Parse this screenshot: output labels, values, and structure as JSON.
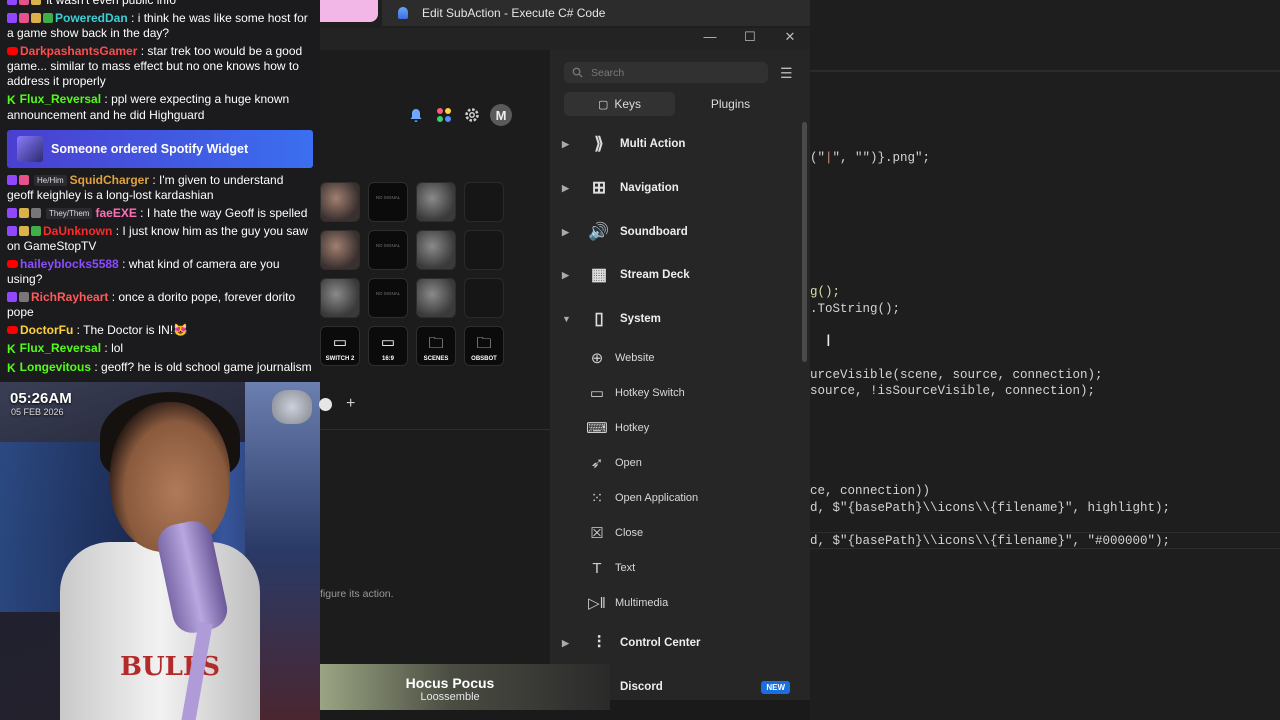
{
  "chat": {
    "messages": [
      {
        "badges": [
          "tw",
          "sub",
          "gold"
        ],
        "user": "",
        "user_color": "#5b8cff",
        "text": "it wasn't even public info"
      },
      {
        "badges": [
          "tw",
          "sub",
          "gold",
          "mod"
        ],
        "user": "PoweredDan",
        "user_color": "#3ad0d6",
        "text": ": i think he was like some host for a game show back in the day?"
      },
      {
        "badges": [
          "yt"
        ],
        "user": "DarkpashantsGamer",
        "user_color": "#ff4d4d",
        "text": ": star trek too would be a good game... similar to mass effect but no one knows how to address it properly"
      },
      {
        "badges": [
          "kick"
        ],
        "user": "Flux_Reversal",
        "user_color": "#53fc18",
        "text": ": ppl were expecting a huge known announcement and he did Highguard"
      },
      {
        "badges": [
          "tw",
          "sub"
        ],
        "pronoun": "He/Him",
        "user": "SquidCharger",
        "user_color": "#e0a23c",
        "text": ": I'm given to understand geoff keighley is a long-lost kardashian"
      },
      {
        "badges": [
          "tw",
          "gold",
          "gray"
        ],
        "pronoun": "They/Them",
        "user": "faeEXE",
        "user_color": "#ff6fb5",
        "text": ": I hate the way Geoff is spelled"
      },
      {
        "badges": [
          "tw",
          "gold",
          "mod"
        ],
        "user": "DaUnknown",
        "user_color": "#ff2a2a",
        "text": ": I just know him as the guy you saw on GameStopTV"
      },
      {
        "badges": [
          "yt"
        ],
        "user": "haileyblocks5588",
        "user_color": "#8a4dff",
        "text": ": what kind of camera are you using?"
      },
      {
        "badges": [
          "tw",
          "gray"
        ],
        "user": "RichRayheart",
        "user_color": "#ff5a5a",
        "text": ": once a dorito pope, forever dorito pope"
      },
      {
        "badges": [
          "yt"
        ],
        "user": "DoctorFu",
        "user_color": "#ffd23c",
        "text": ": The Doctor is IN!😻"
      },
      {
        "badges": [
          "kick"
        ],
        "user": "Flux_Reversal",
        "user_color": "#53fc18",
        "text": ": lol"
      },
      {
        "badges": [
          "kick"
        ],
        "user": "Longevitous",
        "user_color": "#53fc18",
        "text": ": geoff? he is old school game journalism"
      }
    ],
    "alert": "Someone ordered Spotify Widget"
  },
  "overlay": {
    "time": "05:26AM",
    "date": "05 FEB 2026",
    "shirt_text": "BULLS"
  },
  "window": {
    "title": "Edit SubAction - Execute C# Code",
    "controls": [
      "—",
      "☐",
      "✕"
    ]
  },
  "deck": {
    "keys": [
      {
        "label": "SWITCH 2"
      },
      {
        "label": "16:9"
      },
      {
        "label": "SCENES",
        "symbol": "🗀"
      },
      {
        "label": "OBSBOT",
        "symbol": "🗀"
      }
    ],
    "tiny_label": "NO SIGNAL",
    "hint": "figure its action.",
    "add_page": "+",
    "avatar": "M"
  },
  "now_playing": {
    "title": "Hocus Pocus",
    "artist": "Loossemble"
  },
  "actions": {
    "search_placeholder": "Search",
    "tabs": [
      {
        "label": "Keys",
        "active": true
      },
      {
        "label": "Plugins",
        "active": false
      }
    ],
    "categories": [
      {
        "label": "Multi Action",
        "icon": "multi-action-icon",
        "expanded": false
      },
      {
        "label": "Navigation",
        "icon": "navigation-icon",
        "expanded": false
      },
      {
        "label": "Soundboard",
        "icon": "soundboard-icon",
        "expanded": false
      },
      {
        "label": "Stream Deck",
        "icon": "stream-deck-icon",
        "expanded": false
      },
      {
        "label": "System",
        "icon": "system-icon",
        "expanded": true
      },
      {
        "label": "Control Center",
        "icon": "control-center-icon",
        "expanded": false
      },
      {
        "label": "Discord",
        "icon": "discord-icon",
        "expanded": false,
        "badge": "NEW"
      }
    ],
    "system_items": [
      {
        "label": "Website",
        "icon": "globe-icon"
      },
      {
        "label": "Hotkey Switch",
        "icon": "toggle-icon"
      },
      {
        "label": "Hotkey",
        "icon": "keyboard-icon"
      },
      {
        "label": "Open",
        "icon": "rocket-icon"
      },
      {
        "label": "Open Application",
        "icon": "apps-grid-icon"
      },
      {
        "label": "Close",
        "icon": "close-box-icon"
      },
      {
        "label": "Text",
        "icon": "text-icon"
      },
      {
        "label": "Multimedia",
        "icon": "play-pause-icon"
      }
    ]
  },
  "code": {
    "lines": [
      {
        "pre": "(\"",
        "s1": "|",
        "mid": "\", \"",
        "s2": "",
        "post": "\")}.png\";"
      },
      {
        "text": "g();"
      },
      {
        "text": ".ToString();"
      },
      {
        "text": "urceVisible(scene, source, connection);"
      },
      {
        "text": "source, !isSourceVisible, connection);"
      },
      {
        "text": "ce, connection))"
      },
      {
        "text": "d, $\"{basePath}\\\\icons\\\\{filename}\", highlight);"
      },
      {
        "text": "d, $\"{basePath}\\\\icons\\\\{filename}\", \"#000000\");"
      }
    ]
  }
}
